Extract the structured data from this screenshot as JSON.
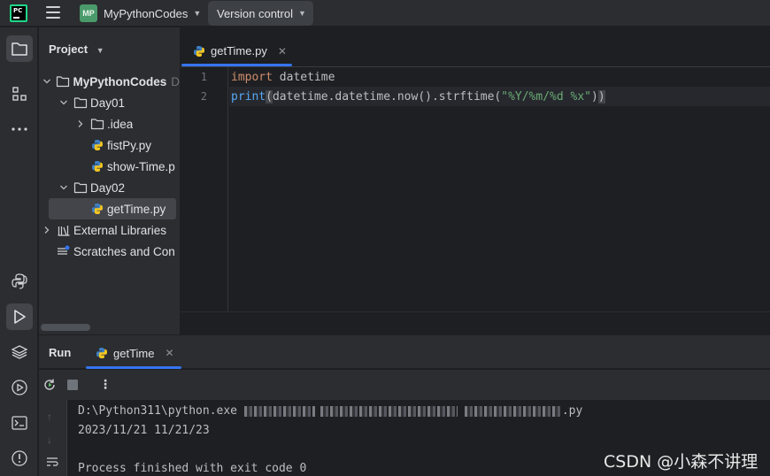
{
  "titlebar": {
    "logo_text": "PC",
    "project_badge": "MP",
    "project_name": "MyPythonCodes",
    "vcs_label": "Version control"
  },
  "left_strip": {
    "icons": [
      "folder-icon",
      "structure-icon",
      "more-icon",
      "python-console-icon",
      "run-icon",
      "layers-icon",
      "services-icon",
      "terminal-icon",
      "problems-icon"
    ]
  },
  "project_panel": {
    "header": "Project",
    "tree": [
      {
        "label": "MyPythonCodes",
        "suffix": "D",
        "level": 0,
        "type": "folder",
        "expanded": true
      },
      {
        "label": "Day01",
        "level": 1,
        "type": "folder",
        "expanded": true
      },
      {
        "label": ".idea",
        "level": 2,
        "type": "folder",
        "expanded": false
      },
      {
        "label": "fistPy.py",
        "level": 2,
        "type": "python"
      },
      {
        "label": "show-Time.p",
        "level": 2,
        "type": "python"
      },
      {
        "label": "Day02",
        "level": 1,
        "type": "folder",
        "expanded": true
      },
      {
        "label": "getTime.py",
        "level": 2,
        "type": "python",
        "selected": true
      },
      {
        "label": "External Libraries",
        "level": 0,
        "type": "library",
        "expanded": false
      },
      {
        "label": "Scratches and Con",
        "level": 0,
        "type": "scratches"
      }
    ]
  },
  "editor": {
    "tab_label": "getTime.py",
    "line_numbers": [
      "1",
      "2"
    ],
    "line1": {
      "kw": "import",
      "rest": " datetime"
    },
    "line2": {
      "fn": "print",
      "open": "(",
      "mid": "datetime.datetime.now().strftime(",
      "str": "\"%Y/%m/%d %x\"",
      "close_inner": ")",
      "close": ")"
    }
  },
  "run_panel": {
    "title": "Run",
    "tab_label": "getTime",
    "console": {
      "cmd_prefix": "D:\\Python311\\python.exe",
      "cmd_suffix": ".py",
      "output": "2023/11/21 11/21/23",
      "exit_message": "Process finished with exit code 0"
    }
  },
  "watermark": "CSDN @小森不讲理",
  "colors": {
    "accent": "#3574f0",
    "keyword": "#cf8e6d",
    "function": "#56a8f5",
    "string": "#6aab73",
    "panel_bg": "#2b2d30",
    "editor_bg": "#1e1f22"
  }
}
